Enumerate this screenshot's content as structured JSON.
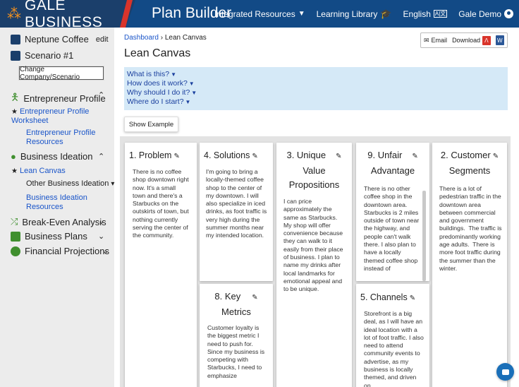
{
  "brand": {
    "logo_glyph": "⁂",
    "name": "GALE BUSINESS",
    "product": "Plan Builder"
  },
  "nav": {
    "integrated": "Integrated Resources",
    "learning": "Learning Library",
    "language": "English",
    "language_badge": "A|文",
    "user": "Gale Demo"
  },
  "sidebar": {
    "company": "Neptune Coffee",
    "company_edit": "edit",
    "scenario": "Scenario #1",
    "change_button": "Change Company/Scenario",
    "sections": {
      "entrepreneur_profile": "Entrepreneur Profile",
      "ep_worksheet": "Entrepreneur Profile Worksheet",
      "ep_resources": "Entrepreneur Profile Resources",
      "business_ideation": "Business Ideation",
      "lean_canvas": "Lean Canvas",
      "other_ideation": "Other Business Ideation",
      "bi_resources": "Business Ideation Resources",
      "break_even": "Break-Even Analysis",
      "business_plans": "Business Plans",
      "financial_projections": "Financial Projections"
    },
    "colors": {
      "entrepreneur": "#3f8f2e",
      "ideation": "#3f8f2e",
      "break_even": "#3f8f2e",
      "plans": "#3f8f2e",
      "financial": "#3f8f2e"
    }
  },
  "main": {
    "breadcrumb_link": "Dashboard",
    "breadcrumb_sep": "›",
    "breadcrumb_current": "Lean Canvas",
    "title": "Lean Canvas",
    "share": {
      "email": "Email",
      "download": "Download",
      "pdf": "PDF",
      "word": "W"
    },
    "faq": [
      "What is this?",
      "How does it work?",
      "Why should I do it?",
      "Where do I start?"
    ],
    "show_example": "Show Example"
  },
  "canvas": {
    "problem": {
      "title": "1. Problem",
      "body": "There is no coffee shop downtown right now. It's a small town and there's a Starbucks on the outskirts of town, but nothing currently serving the center of the community."
    },
    "solutions": {
      "title": "4. Solutions",
      "body": "I'm going to bring a locally-themed coffee shop to the center of my downtown. I will also specialize in iced drinks, as foot traffic is very high during the summer months near my intended location."
    },
    "uvp": {
      "title_1": "3. Unique",
      "title_2": "Value",
      "title_3": "Propositions",
      "body": "I can price approximately the same as Starbucks.  My shop will offer convenience because they can walk to it easily from their place of business. I plan to name my drinks after local landmarks for emotional appeal and to be unique."
    },
    "unfair": {
      "title_1": "9. Unfair",
      "title_2": "Advantage",
      "body": "There is no other coffee shop in the downtown area.  Starbucks is 2 miles outside of town near the highway, and people can't walk there. I also plan to have a locally themed coffee shop instead of"
    },
    "segments": {
      "title_1": "2. Customer",
      "title_2": "Segments",
      "body": "There is a lot of pedestrian traffic in the downtown area between commercial and government buildings.  The traffic is predominantly working age adults.  There is more foot traffic during the summer than the winter."
    },
    "metrics": {
      "title_1": "8. Key",
      "title_2": "Metrics",
      "body": "Customer loyalty is the biggest metric I need to push for.  Since my business is competing with Starbucks, I need to emphasize"
    },
    "channels": {
      "title": "5. Channels",
      "body": "Storefront is a big deal, as I will have an ideal location with a lot of foot traffic. I also need to attend community events to advertise, as my business is locally themed, and driven on"
    }
  }
}
